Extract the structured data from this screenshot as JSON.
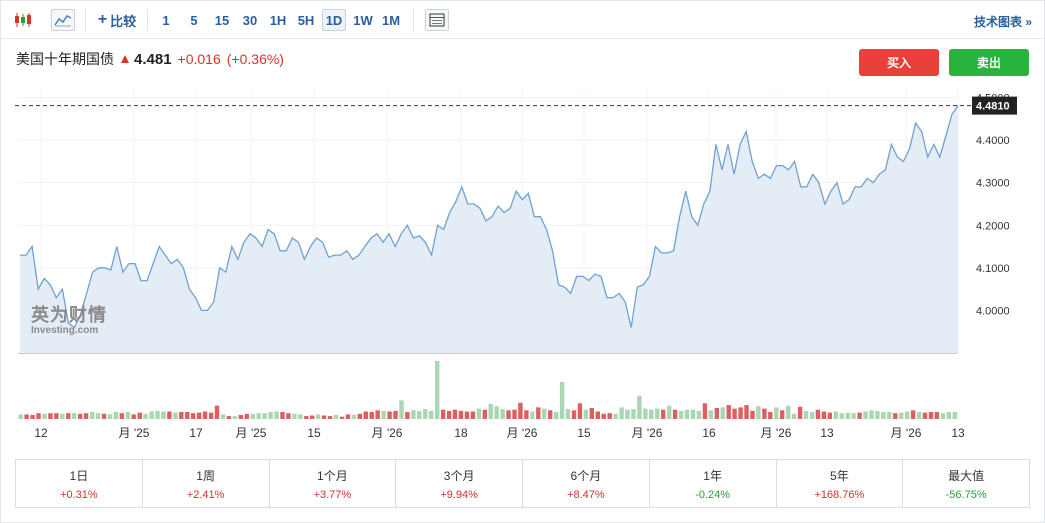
{
  "toolbar": {
    "compare_label": "比较",
    "timeframes": [
      "1",
      "5",
      "15",
      "30",
      "1H",
      "5H",
      "1D",
      "1W",
      "1M"
    ],
    "active_timeframe": "1D",
    "tech_chart_label": "技术图表 »"
  },
  "quote": {
    "name": "美国十年期国债",
    "price": "4.481",
    "change": "+0.016",
    "change_pct": "(+0.36%)"
  },
  "actions": {
    "buy_label": "买入",
    "sell_label": "卖出"
  },
  "watermark": {
    "cn": "英为财情",
    "en": "Investing.com"
  },
  "chart_data": {
    "type": "area",
    "last_price_label": "4.4810",
    "last_price": 4.481,
    "y_ticks": [
      "4.5000",
      "4.4000",
      "4.3000",
      "4.2000",
      "4.1000",
      "4.0000"
    ],
    "x_labels": [
      "12",
      "月 '25",
      "17",
      "月 '25",
      "15",
      "月 '26",
      "18",
      "月 '26",
      "15",
      "月 '26",
      "16",
      "月 '26",
      "13",
      "月 '26",
      "13"
    ],
    "values": [
      4.13,
      4.13,
      4.15,
      4.05,
      4.075,
      4.06,
      4.03,
      4.05,
      3.97,
      3.96,
      3.99,
      4.04,
      4.09,
      4.1,
      4.1,
      4.095,
      4.15,
      4.09,
      4.11,
      4.11,
      4.07,
      4.07,
      4.11,
      4.15,
      4.13,
      4.11,
      4.12,
      4.1,
      4.05,
      4.03,
      4.0,
      4.0,
      4.02,
      4.1,
      4.09,
      4.15,
      4.12,
      4.16,
      4.18,
      4.17,
      4.15,
      4.19,
      4.18,
      4.14,
      4.14,
      4.17,
      4.16,
      4.12,
      4.15,
      4.17,
      4.16,
      4.125,
      4.13,
      4.13,
      4.14,
      4.12,
      4.13,
      4.15,
      4.17,
      4.18,
      4.16,
      4.18,
      4.15,
      4.18,
      4.2,
      4.17,
      4.175,
      4.16,
      4.13,
      4.2,
      4.19,
      4.23,
      4.255,
      4.29,
      4.25,
      4.25,
      4.24,
      4.21,
      4.22,
      4.245,
      4.23,
      4.24,
      4.28,
      4.26,
      4.275,
      4.22,
      4.22,
      4.19,
      4.14,
      4.06,
      4.055,
      4.04,
      4.08,
      4.08,
      4.07,
      4.085,
      4.08,
      4.03,
      4.03,
      4.04,
      4.02,
      3.96,
      4.055,
      4.06,
      4.08,
      4.15,
      4.135,
      4.135,
      4.14,
      4.22,
      4.28,
      4.22,
      4.2,
      4.25,
      4.28,
      4.39,
      4.33,
      4.39,
      4.32,
      4.39,
      4.42,
      4.35,
      4.31,
      4.32,
      4.31,
      4.34,
      4.34,
      4.33,
      4.35,
      4.29,
      4.29,
      4.32,
      4.3,
      4.25,
      4.28,
      4.3,
      4.25,
      4.26,
      4.29,
      4.29,
      4.31,
      4.3,
      4.32,
      4.33,
      4.39,
      4.36,
      4.35,
      4.38,
      4.44,
      4.42,
      4.36,
      4.39,
      4.36,
      4.41,
      4.46,
      4.481
    ],
    "volume_bars": [
      {
        "v": 0.08,
        "d": "up"
      },
      {
        "v": 0.08,
        "d": "down"
      },
      {
        "v": 0.07,
        "d": "down"
      },
      {
        "v": 0.1,
        "d": "down"
      },
      {
        "v": 0.09,
        "d": "up"
      },
      {
        "v": 0.1,
        "d": "down"
      },
      {
        "v": 0.1,
        "d": "down"
      },
      {
        "v": 0.09,
        "d": "up"
      },
      {
        "v": 0.1,
        "d": "down"
      },
      {
        "v": 0.1,
        "d": "up"
      },
      {
        "v": 0.09,
        "d": "down"
      },
      {
        "v": 0.1,
        "d": "down"
      },
      {
        "v": 0.12,
        "d": "up"
      },
      {
        "v": 0.1,
        "d": "up"
      },
      {
        "v": 0.09,
        "d": "down"
      },
      {
        "v": 0.08,
        "d": "up"
      },
      {
        "v": 0.12,
        "d": "up"
      },
      {
        "v": 0.1,
        "d": "down"
      },
      {
        "v": 0.12,
        "d": "up"
      },
      {
        "v": 0.08,
        "d": "down"
      },
      {
        "v": 0.11,
        "d": "down"
      },
      {
        "v": 0.09,
        "d": "up"
      },
      {
        "v": 0.13,
        "d": "up"
      },
      {
        "v": 0.14,
        "d": "up"
      },
      {
        "v": 0.13,
        "d": "up"
      },
      {
        "v": 0.13,
        "d": "down"
      },
      {
        "v": 0.11,
        "d": "up"
      },
      {
        "v": 0.12,
        "d": "down"
      },
      {
        "v": 0.12,
        "d": "down"
      },
      {
        "v": 0.1,
        "d": "down"
      },
      {
        "v": 0.11,
        "d": "down"
      },
      {
        "v": 0.13,
        "d": "down"
      },
      {
        "v": 0.11,
        "d": "down"
      },
      {
        "v": 0.23,
        "d": "down"
      },
      {
        "v": 0.08,
        "d": "up"
      },
      {
        "v": 0.05,
        "d": "down"
      },
      {
        "v": 0.05,
        "d": "up"
      },
      {
        "v": 0.07,
        "d": "down"
      },
      {
        "v": 0.09,
        "d": "down"
      },
      {
        "v": 0.09,
        "d": "up"
      },
      {
        "v": 0.1,
        "d": "up"
      },
      {
        "v": 0.1,
        "d": "up"
      },
      {
        "v": 0.12,
        "d": "up"
      },
      {
        "v": 0.13,
        "d": "up"
      },
      {
        "v": 0.12,
        "d": "down"
      },
      {
        "v": 0.1,
        "d": "down"
      },
      {
        "v": 0.09,
        "d": "up"
      },
      {
        "v": 0.08,
        "d": "up"
      },
      {
        "v": 0.05,
        "d": "down"
      },
      {
        "v": 0.06,
        "d": "down"
      },
      {
        "v": 0.08,
        "d": "up"
      },
      {
        "v": 0.06,
        "d": "down"
      },
      {
        "v": 0.05,
        "d": "down"
      },
      {
        "v": 0.07,
        "d": "up"
      },
      {
        "v": 0.04,
        "d": "down"
      },
      {
        "v": 0.08,
        "d": "down"
      },
      {
        "v": 0.07,
        "d": "up"
      },
      {
        "v": 0.09,
        "d": "down"
      },
      {
        "v": 0.13,
        "d": "down"
      },
      {
        "v": 0.12,
        "d": "down"
      },
      {
        "v": 0.15,
        "d": "down"
      },
      {
        "v": 0.14,
        "d": "up"
      },
      {
        "v": 0.13,
        "d": "down"
      },
      {
        "v": 0.14,
        "d": "down"
      },
      {
        "v": 0.32,
        "d": "up"
      },
      {
        "v": 0.12,
        "d": "down"
      },
      {
        "v": 0.15,
        "d": "up"
      },
      {
        "v": 0.14,
        "d": "up"
      },
      {
        "v": 0.17,
        "d": "up"
      },
      {
        "v": 0.14,
        "d": "up"
      },
      {
        "v": 1.0,
        "d": "up"
      },
      {
        "v": 0.16,
        "d": "down"
      },
      {
        "v": 0.14,
        "d": "down"
      },
      {
        "v": 0.16,
        "d": "down"
      },
      {
        "v": 0.14,
        "d": "down"
      },
      {
        "v": 0.13,
        "d": "down"
      },
      {
        "v": 0.13,
        "d": "down"
      },
      {
        "v": 0.18,
        "d": "up"
      },
      {
        "v": 0.16,
        "d": "down"
      },
      {
        "v": 0.26,
        "d": "up"
      },
      {
        "v": 0.22,
        "d": "up"
      },
      {
        "v": 0.17,
        "d": "up"
      },
      {
        "v": 0.15,
        "d": "down"
      },
      {
        "v": 0.16,
        "d": "down"
      },
      {
        "v": 0.28,
        "d": "down"
      },
      {
        "v": 0.15,
        "d": "down"
      },
      {
        "v": 0.13,
        "d": "up"
      },
      {
        "v": 0.2,
        "d": "down"
      },
      {
        "v": 0.18,
        "d": "up"
      },
      {
        "v": 0.15,
        "d": "down"
      },
      {
        "v": 0.12,
        "d": "up"
      },
      {
        "v": 0.64,
        "d": "up"
      },
      {
        "v": 0.17,
        "d": "up"
      },
      {
        "v": 0.15,
        "d": "down"
      },
      {
        "v": 0.27,
        "d": "down"
      },
      {
        "v": 0.16,
        "d": "up"
      },
      {
        "v": 0.19,
        "d": "down"
      },
      {
        "v": 0.13,
        "d": "down"
      },
      {
        "v": 0.09,
        "d": "down"
      },
      {
        "v": 0.1,
        "d": "down"
      },
      {
        "v": 0.09,
        "d": "up"
      },
      {
        "v": 0.2,
        "d": "up"
      },
      {
        "v": 0.16,
        "d": "up"
      },
      {
        "v": 0.17,
        "d": "up"
      },
      {
        "v": 0.4,
        "d": "up"
      },
      {
        "v": 0.18,
        "d": "up"
      },
      {
        "v": 0.16,
        "d": "up"
      },
      {
        "v": 0.18,
        "d": "up"
      },
      {
        "v": 0.16,
        "d": "down"
      },
      {
        "v": 0.23,
        "d": "up"
      },
      {
        "v": 0.16,
        "d": "down"
      },
      {
        "v": 0.14,
        "d": "up"
      },
      {
        "v": 0.16,
        "d": "up"
      },
      {
        "v": 0.16,
        "d": "up"
      },
      {
        "v": 0.14,
        "d": "up"
      },
      {
        "v": 0.27,
        "d": "down"
      },
      {
        "v": 0.15,
        "d": "up"
      },
      {
        "v": 0.19,
        "d": "down"
      },
      {
        "v": 0.2,
        "d": "up"
      },
      {
        "v": 0.24,
        "d": "down"
      },
      {
        "v": 0.18,
        "d": "down"
      },
      {
        "v": 0.2,
        "d": "down"
      },
      {
        "v": 0.24,
        "d": "down"
      },
      {
        "v": 0.14,
        "d": "down"
      },
      {
        "v": 0.22,
        "d": "up"
      },
      {
        "v": 0.18,
        "d": "down"
      },
      {
        "v": 0.12,
        "d": "down"
      },
      {
        "v": 0.2,
        "d": "up"
      },
      {
        "v": 0.15,
        "d": "down"
      },
      {
        "v": 0.23,
        "d": "up"
      },
      {
        "v": 0.09,
        "d": "up"
      },
      {
        "v": 0.21,
        "d": "down"
      },
      {
        "v": 0.14,
        "d": "up"
      },
      {
        "v": 0.12,
        "d": "up"
      },
      {
        "v": 0.16,
        "d": "down"
      },
      {
        "v": 0.13,
        "d": "down"
      },
      {
        "v": 0.11,
        "d": "down"
      },
      {
        "v": 0.13,
        "d": "up"
      },
      {
        "v": 0.1,
        "d": "up"
      },
      {
        "v": 0.11,
        "d": "up"
      },
      {
        "v": 0.1,
        "d": "up"
      },
      {
        "v": 0.11,
        "d": "down"
      },
      {
        "v": 0.13,
        "d": "up"
      },
      {
        "v": 0.15,
        "d": "up"
      },
      {
        "v": 0.14,
        "d": "up"
      },
      {
        "v": 0.12,
        "d": "up"
      },
      {
        "v": 0.12,
        "d": "up"
      },
      {
        "v": 0.1,
        "d": "down"
      },
      {
        "v": 0.11,
        "d": "up"
      },
      {
        "v": 0.13,
        "d": "up"
      },
      {
        "v": 0.15,
        "d": "down"
      },
      {
        "v": 0.12,
        "d": "up"
      },
      {
        "v": 0.11,
        "d": "down"
      },
      {
        "v": 0.12,
        "d": "down"
      },
      {
        "v": 0.12,
        "d": "down"
      },
      {
        "v": 0.1,
        "d": "up"
      },
      {
        "v": 0.12,
        "d": "up"
      },
      {
        "v": 0.12,
        "d": "up"
      }
    ],
    "colors": {
      "line": "#6fa1d3",
      "area": "#e4edf6",
      "up_volume": "#a9d6b4",
      "down_volume": "#db6060",
      "last_price_bg": "#222222"
    },
    "ylim": [
      3.9,
      4.52
    ]
  },
  "periods": [
    {
      "label": "1日",
      "value": "+0.31%",
      "dir": "up"
    },
    {
      "label": "1周",
      "value": "+2.41%",
      "dir": "up"
    },
    {
      "label": "1个月",
      "value": "+3.77%",
      "dir": "up"
    },
    {
      "label": "3个月",
      "value": "+9.94%",
      "dir": "up"
    },
    {
      "label": "6个月",
      "value": "+8.47%",
      "dir": "up"
    },
    {
      "label": "1年",
      "value": "-0.24%",
      "dir": "down"
    },
    {
      "label": "5年",
      "value": "+168.76%",
      "dir": "up"
    },
    {
      "label": "最大值",
      "value": "-56.75%",
      "dir": "down"
    }
  ]
}
